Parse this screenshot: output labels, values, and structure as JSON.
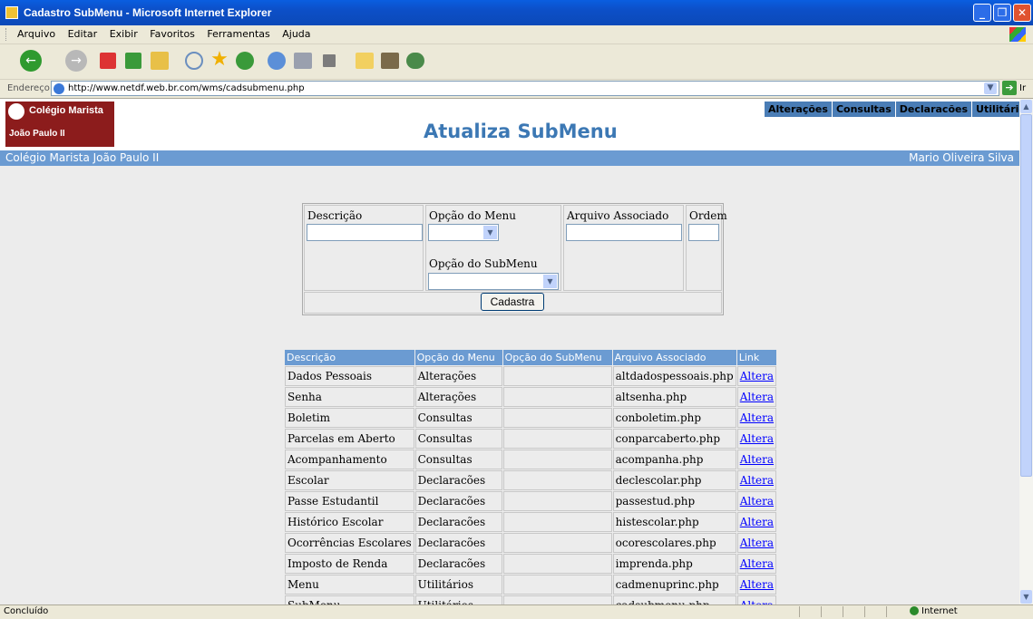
{
  "window": {
    "title": "Cadastro SubMenu - Microsoft Internet Explorer"
  },
  "menubar": [
    "Arquivo",
    "Editar",
    "Exibir",
    "Favoritos",
    "Ferramentas",
    "Ajuda"
  ],
  "address": {
    "label": "Endereço",
    "url": "http://www.netdf.web.br.com/wms/cadsubmenu.php",
    "go": "Ir"
  },
  "header": {
    "logo_line1": "Colégio Marista",
    "logo_line2": "João Paulo II",
    "page_title": "Atualiza SubMenu",
    "nav": [
      "Alterações",
      "Consultas",
      "Declaracões",
      "Utilitários"
    ],
    "school": "Colégio Marista João Paulo II",
    "user": "Mario Oliveira Silva"
  },
  "form": {
    "descricao": "Descrição",
    "opcao_menu": "Opção do Menu",
    "opcao_submenu": "Opção do SubMenu",
    "arquivo": "Arquivo Associado",
    "ordem": "Ordem",
    "submit": "Cadastra"
  },
  "table": {
    "headers": [
      "Descrição",
      "Opção do Menu",
      "Opção do SubMenu",
      "Arquivo Associado",
      "Link"
    ],
    "rows": [
      [
        "Dados Pessoais",
        "Alterações",
        "",
        "altdadospessoais.php",
        "Altera"
      ],
      [
        "Senha",
        "Alterações",
        "",
        "altsenha.php",
        "Altera"
      ],
      [
        "Boletim",
        "Consultas",
        "",
        "conboletim.php",
        "Altera"
      ],
      [
        "Parcelas em Aberto",
        "Consultas",
        "",
        "conparcaberto.php",
        "Altera"
      ],
      [
        "Acompanhamento",
        "Consultas",
        "",
        "acompanha.php",
        "Altera"
      ],
      [
        "Escolar",
        "Declaracões",
        "",
        "declescolar.php",
        "Altera"
      ],
      [
        "Passe Estudantil",
        "Declaracões",
        "",
        "passestud.php",
        "Altera"
      ],
      [
        "Histórico Escolar",
        "Declaracões",
        "",
        "histescolar.php",
        "Altera"
      ],
      [
        "Ocorrências Escolares",
        "Declaracões",
        "",
        "ocorescolares.php",
        "Altera"
      ],
      [
        "Imposto de Renda",
        "Declaracões",
        "",
        "imprenda.php",
        "Altera"
      ],
      [
        "Menu",
        "Utilitários",
        "",
        "cadmenuprinc.php",
        "Altera"
      ],
      [
        "SubMenu",
        "Utilitários",
        "",
        "cadsubmenu.php",
        "Altera"
      ]
    ]
  },
  "status": {
    "left": "Concluído",
    "zone": "Internet"
  }
}
